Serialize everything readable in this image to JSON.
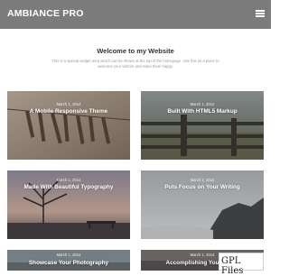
{
  "header": {
    "site_title": "AMBIANCE PRO",
    "menu_icon": "hamburger-menu-icon"
  },
  "welcome": {
    "title": "Welcome to my Website",
    "text": "This is a special widget area which can be shown at the top of the homepage. Use this as a place to welcome your visitors and make them happy."
  },
  "posts": [
    {
      "date": "March 1, 2014",
      "title": "A Mobile Responsive Theme"
    },
    {
      "date": "March 1, 2014",
      "title": "Built With HTML5 Markup"
    },
    {
      "date": "March 1, 2014",
      "title": "Made With Beautiful Typography"
    },
    {
      "date": "March 1, 2014",
      "title": "Puts Focus on Your Writing"
    },
    {
      "date": "March 1, 2014",
      "title": "Showcase Your Photography"
    },
    {
      "date": "March 1, 2014",
      "title": "Accomplishing Your Goals"
    }
  ],
  "watermark": {
    "text": "GPL Files"
  },
  "colors": {
    "header_bg": "#7b7b7b",
    "header_text": "#ffffff"
  }
}
